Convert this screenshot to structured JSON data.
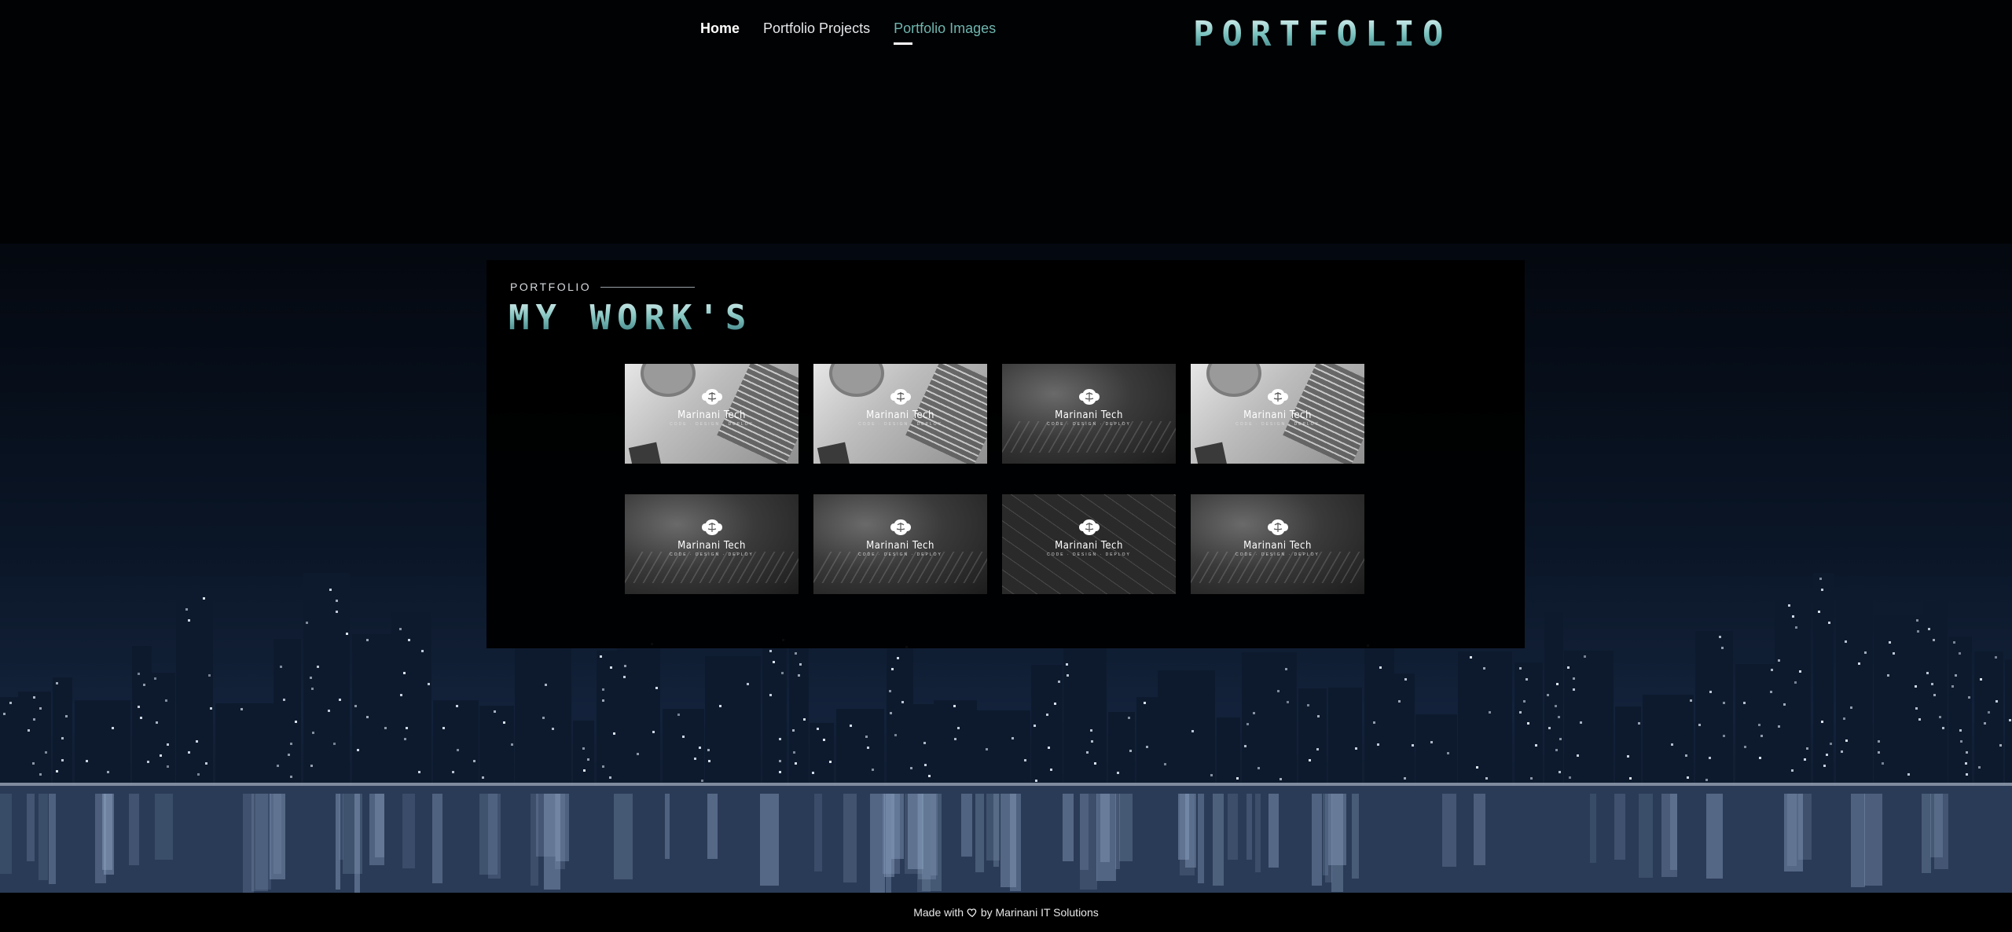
{
  "nav": {
    "items": [
      {
        "label": "Home"
      },
      {
        "label": "Portfolio Projects"
      },
      {
        "label": "Portfolio Images"
      }
    ]
  },
  "logo": {
    "text": "PORTFOLIO"
  },
  "section": {
    "eyebrow": "PORTFOLIO",
    "title": "MY WORK'S"
  },
  "gallery": {
    "brand_name": "Marinani Tech",
    "brand_tagline": "CODE · DESIGN · DEPLOY",
    "items": [
      {
        "style": "laptop"
      },
      {
        "style": "laptop"
      },
      {
        "style": "keys"
      },
      {
        "style": "laptop"
      },
      {
        "style": "keys"
      },
      {
        "style": "keys"
      },
      {
        "style": "pattern"
      },
      {
        "style": "keys"
      }
    ]
  },
  "footer": {
    "prefix": "Made with",
    "icon": "heart-icon",
    "suffix": "by Marinani IT Solutions"
  },
  "colors": {
    "accent": "#6fb5ae",
    "background": "#000000",
    "text": "#ffffff"
  }
}
